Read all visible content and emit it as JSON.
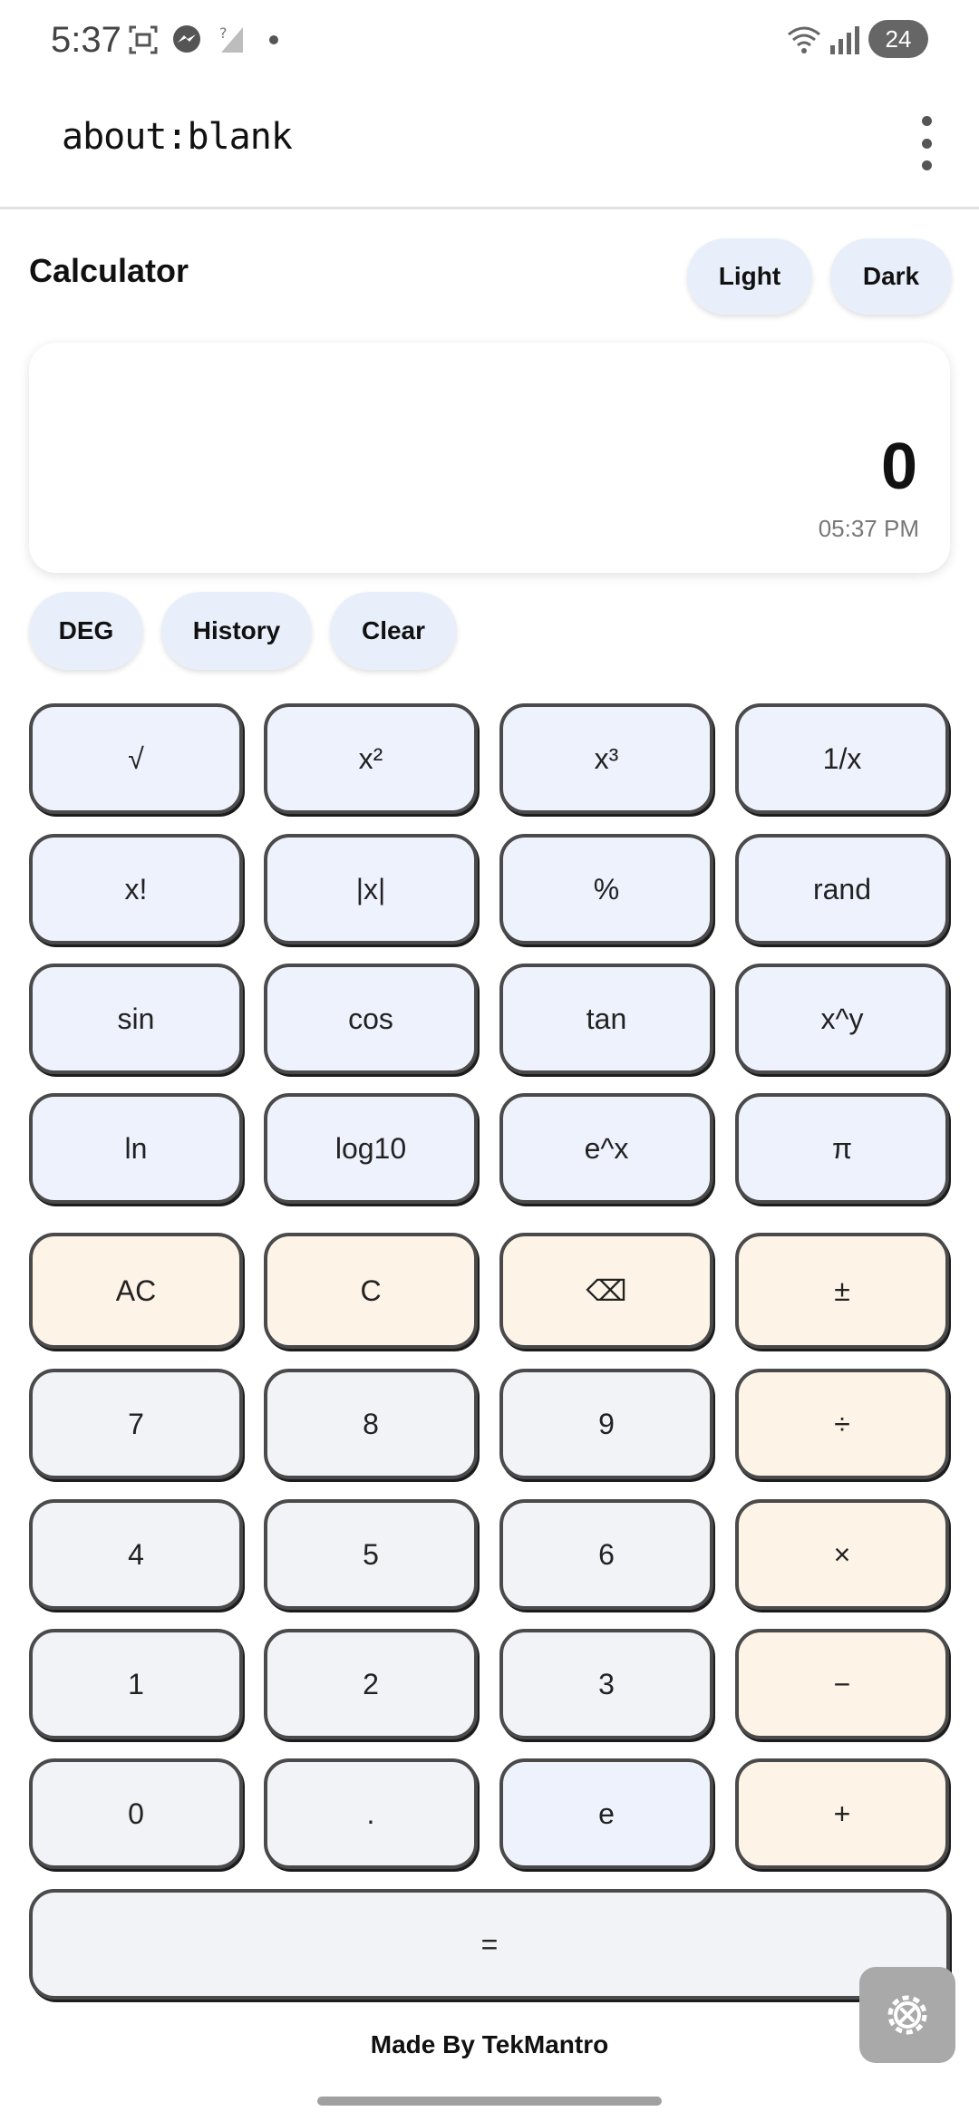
{
  "status_bar": {
    "time": "5:37",
    "battery": "24",
    "icons": [
      "screenshot-icon",
      "messenger-icon",
      "no-signal-icon",
      "dot-icon",
      "wifi-icon",
      "signal-icon"
    ]
  },
  "browser": {
    "url": "about:blank",
    "menu_icon": "kebab-menu-icon"
  },
  "header": {
    "title": "Calculator",
    "light_label": "Light",
    "dark_label": "Dark"
  },
  "display": {
    "value": "0",
    "time": "05:37 PM"
  },
  "controls": {
    "deg_label": "DEG",
    "history_label": "History",
    "clear_label": "Clear"
  },
  "keys": {
    "sci": [
      "√",
      "x²",
      "x³",
      "1/x",
      "x!",
      "|x|",
      "%",
      "rand",
      "sin",
      "cos",
      "tan",
      "x^y",
      "ln",
      "log10",
      "e^x",
      "π"
    ],
    "main": [
      "AC",
      "C",
      "⌫",
      "±",
      "7",
      "8",
      "9",
      "÷",
      "4",
      "5",
      "6",
      "×",
      "1",
      "2",
      "3",
      "−",
      "0",
      ".",
      "e",
      "+"
    ],
    "equals": "="
  },
  "footer": {
    "text": "Made By TekMantro"
  },
  "colors": {
    "sci_key": "#eef2fd",
    "op_key": "#fdf3e6",
    "num_key": "#f2f3f6",
    "pill": "#e9effa"
  }
}
